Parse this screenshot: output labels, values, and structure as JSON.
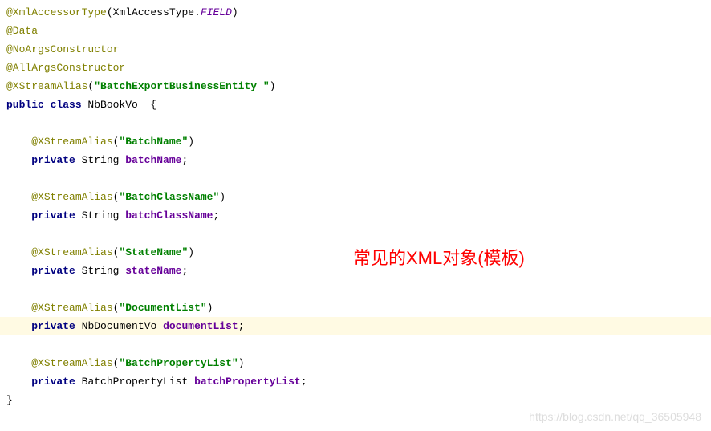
{
  "code": {
    "lines": [
      {
        "segments": [
          {
            "cls": "annotation",
            "t": "@XmlAccessorType"
          },
          {
            "cls": "punct",
            "t": "(XmlAccessType."
          },
          {
            "cls": "italic-const",
            "t": "FIELD"
          },
          {
            "cls": "punct",
            "t": ")"
          }
        ],
        "indent": 0
      },
      {
        "segments": [
          {
            "cls": "annotation",
            "t": "@Data"
          }
        ],
        "indent": 0
      },
      {
        "segments": [
          {
            "cls": "annotation",
            "t": "@NoArgsConstructor"
          }
        ],
        "indent": 0
      },
      {
        "segments": [
          {
            "cls": "annotation",
            "t": "@AllArgsConstructor"
          }
        ],
        "indent": 0
      },
      {
        "segments": [
          {
            "cls": "annotation",
            "t": "@XStreamAlias"
          },
          {
            "cls": "punct",
            "t": "("
          },
          {
            "cls": "string",
            "t": "\"BatchExportBusinessEntity \""
          },
          {
            "cls": "punct",
            "t": ")"
          }
        ],
        "indent": 0
      },
      {
        "segments": [
          {
            "cls": "keyword",
            "t": "public class "
          },
          {
            "cls": "type",
            "t": "NbBookVo  {"
          }
        ],
        "indent": 0
      },
      {
        "segments": [],
        "indent": 0
      },
      {
        "segments": [
          {
            "cls": "annotation",
            "t": "@XStreamAlias"
          },
          {
            "cls": "punct",
            "t": "("
          },
          {
            "cls": "string",
            "t": "\"BatchName\""
          },
          {
            "cls": "punct",
            "t": ")"
          }
        ],
        "indent": 1
      },
      {
        "segments": [
          {
            "cls": "keyword",
            "t": "private "
          },
          {
            "cls": "type",
            "t": "String "
          },
          {
            "cls": "field",
            "t": "batchName"
          },
          {
            "cls": "punct",
            "t": ";"
          }
        ],
        "indent": 1
      },
      {
        "segments": [],
        "indent": 0
      },
      {
        "segments": [
          {
            "cls": "annotation",
            "t": "@XStreamAlias"
          },
          {
            "cls": "punct",
            "t": "("
          },
          {
            "cls": "string",
            "t": "\"BatchClassName\""
          },
          {
            "cls": "punct",
            "t": ")"
          }
        ],
        "indent": 1
      },
      {
        "segments": [
          {
            "cls": "keyword",
            "t": "private "
          },
          {
            "cls": "type",
            "t": "String "
          },
          {
            "cls": "field",
            "t": "batchClassName"
          },
          {
            "cls": "punct",
            "t": ";"
          }
        ],
        "indent": 1
      },
      {
        "segments": [],
        "indent": 0
      },
      {
        "segments": [
          {
            "cls": "annotation",
            "t": "@XStreamAlias"
          },
          {
            "cls": "punct",
            "t": "("
          },
          {
            "cls": "string",
            "t": "\"StateName\""
          },
          {
            "cls": "punct",
            "t": ")"
          }
        ],
        "indent": 1
      },
      {
        "segments": [
          {
            "cls": "keyword",
            "t": "private "
          },
          {
            "cls": "type",
            "t": "String "
          },
          {
            "cls": "field",
            "t": "stateName"
          },
          {
            "cls": "punct",
            "t": ";"
          }
        ],
        "indent": 1
      },
      {
        "segments": [],
        "indent": 0
      },
      {
        "segments": [
          {
            "cls": "annotation",
            "t": "@XStreamAlias"
          },
          {
            "cls": "punct",
            "t": "("
          },
          {
            "cls": "string",
            "t": "\"DocumentList\""
          },
          {
            "cls": "punct",
            "t": ")"
          }
        ],
        "indent": 1
      },
      {
        "segments": [
          {
            "cls": "keyword",
            "t": "private "
          },
          {
            "cls": "type",
            "t": "NbDocumentVo "
          },
          {
            "cls": "field",
            "t": "documentList"
          },
          {
            "cls": "punct",
            "t": ";"
          }
        ],
        "indent": 1,
        "highlighted": true
      },
      {
        "segments": [],
        "indent": 0
      },
      {
        "segments": [
          {
            "cls": "annotation",
            "t": "@XStreamAlias"
          },
          {
            "cls": "punct",
            "t": "("
          },
          {
            "cls": "string",
            "t": "\"BatchPropertyList\""
          },
          {
            "cls": "punct",
            "t": ")"
          }
        ],
        "indent": 1
      },
      {
        "segments": [
          {
            "cls": "keyword",
            "t": "private "
          },
          {
            "cls": "type",
            "t": "BatchPropertyList "
          },
          {
            "cls": "field",
            "t": "batchPropertyList"
          },
          {
            "cls": "punct",
            "t": ";"
          }
        ],
        "indent": 1
      },
      {
        "segments": [
          {
            "cls": "punct",
            "t": "}"
          }
        ],
        "indent": 0
      }
    ]
  },
  "overlay": "常见的XML对象(模板)",
  "watermark": "https://blog.csdn.net/qq_36505948"
}
